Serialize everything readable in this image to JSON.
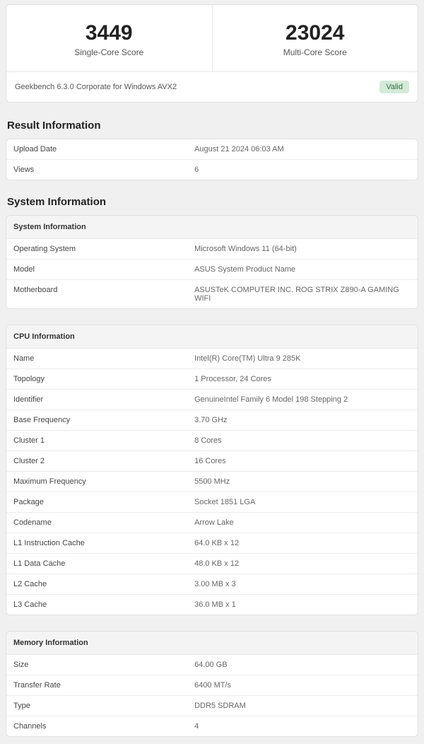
{
  "scores": {
    "single_value": "3449",
    "single_label": "Single-Core Score",
    "multi_value": "23024",
    "multi_label": "Multi-Core Score"
  },
  "version_line": "Geekbench 6.3.0 Corporate for Windows AVX2",
  "valid_badge": "Valid",
  "result_info": {
    "title": "Result Information",
    "rows": [
      {
        "k": "Upload Date",
        "v": "August 21 2024 06:03 AM"
      },
      {
        "k": "Views",
        "v": "6"
      }
    ]
  },
  "system_info_title": "System Information",
  "system_info": {
    "header": "System Information",
    "rows": [
      {
        "k": "Operating System",
        "v": "Microsoft Windows 11 (64-bit)"
      },
      {
        "k": "Model",
        "v": "ASUS System Product Name"
      },
      {
        "k": "Motherboard",
        "v": "ASUSTeK COMPUTER INC. ROG STRIX Z890-A GAMING WIFI"
      }
    ]
  },
  "cpu_info": {
    "header": "CPU Information",
    "rows": [
      {
        "k": "Name",
        "v": "Intel(R) Core(TM) Ultra 9 285K"
      },
      {
        "k": "Topology",
        "v": "1 Processor, 24 Cores"
      },
      {
        "k": "Identifier",
        "v": "GenuineIntel Family 6 Model 198 Stepping 2"
      },
      {
        "k": "Base Frequency",
        "v": "3.70 GHz"
      },
      {
        "k": "Cluster 1",
        "v": "8 Cores"
      },
      {
        "k": "Cluster 2",
        "v": "16 Cores"
      },
      {
        "k": "Maximum Frequency",
        "v": "5500 MHz"
      },
      {
        "k": "Package",
        "v": "Socket 1851 LGA"
      },
      {
        "k": "Codename",
        "v": "Arrow Lake"
      },
      {
        "k": "L1 Instruction Cache",
        "v": "64.0 KB x 12"
      },
      {
        "k": "L1 Data Cache",
        "v": "48.0 KB x 12"
      },
      {
        "k": "L2 Cache",
        "v": "3.00 MB x 3"
      },
      {
        "k": "L3 Cache",
        "v": "36.0 MB x 1"
      }
    ]
  },
  "mem_info": {
    "header": "Memory Information",
    "rows": [
      {
        "k": "Size",
        "v": "64.00 GB"
      },
      {
        "k": "Transfer Rate",
        "v": "6400 MT/s"
      },
      {
        "k": "Type",
        "v": "DDR5 SDRAM"
      },
      {
        "k": "Channels",
        "v": "4"
      }
    ]
  }
}
